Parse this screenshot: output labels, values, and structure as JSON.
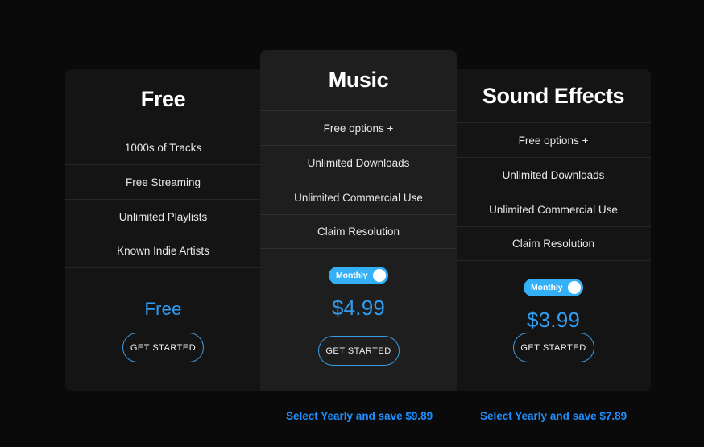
{
  "accent_colors": {
    "blue": "#34b0f7",
    "price_blue": "#2f9cf0",
    "link_blue": "#1f8fff",
    "page_background": "#0a0a0a",
    "card_background": "#141414",
    "featured_card_background": "#1e1e1e"
  },
  "plans": [
    {
      "id": "free",
      "title": "Free",
      "features": [
        "1000s of Tracks",
        "Free Streaming",
        "Unlimited Playlists",
        "Known Indie Artists"
      ],
      "has_toggle": false,
      "price": "Free",
      "cta_label": "GET STARTED",
      "yearly_note": null
    },
    {
      "id": "music",
      "title": "Music",
      "features": [
        "Free options +",
        "Unlimited Downloads",
        "Unlimited Commercial Use",
        "Claim Resolution"
      ],
      "has_toggle": true,
      "toggle_label": "Monthly",
      "price": "$4.99",
      "cta_label": "GET STARTED",
      "yearly_note": "Select Yearly and save $9.89"
    },
    {
      "id": "sound-effects",
      "title": "Sound Effects",
      "features": [
        "Free options +",
        "Unlimited Downloads",
        "Unlimited Commercial Use",
        "Claim Resolution"
      ],
      "has_toggle": true,
      "toggle_label": "Monthly",
      "price": "$3.99",
      "cta_label": "GET STARTED",
      "yearly_note": "Select Yearly and save $7.89"
    }
  ]
}
